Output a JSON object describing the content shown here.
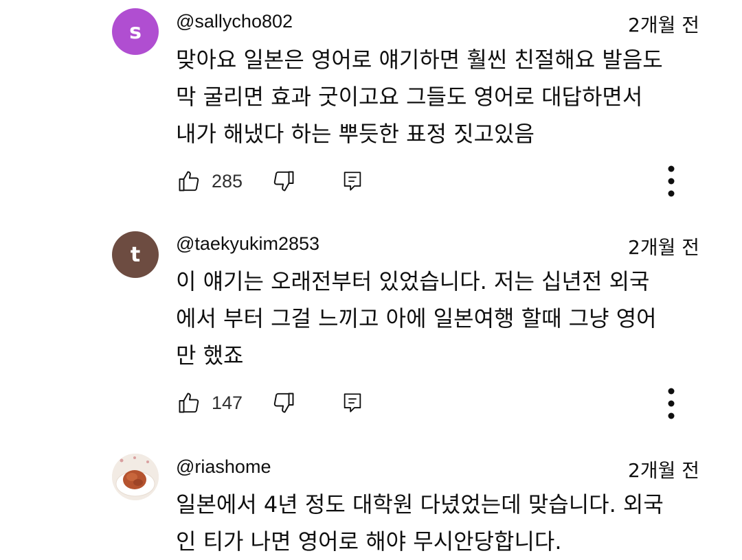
{
  "comments": [
    {
      "avatar_letter": "s",
      "avatar_color": "#b04ed1",
      "handle": "@sallycho802",
      "time": "2개월 전",
      "text": "맞아요 일본은 영어로 얘기하면 훨씬 친절해요 발음도\n막 굴리면 효과 굿이고요 그들도 영어로 대답하면서\n내가 해냈다 하는 뿌듯한 표정 짓고있음",
      "likes": "285"
    },
    {
      "avatar_letter": "t",
      "avatar_color": "#6d4c41",
      "handle": "@taekyukim2853",
      "time": "2개월 전",
      "text": "이 얘기는 오래전부터 있었습니다. 저는 십년전 외국\n에서 부터 그걸 느끼고  아에 일본여행 할때 그냥 영어\n만 했죠",
      "likes": "147"
    },
    {
      "avatar_letter": "",
      "avatar_color": "#f3ece6",
      "handle": "@riashome",
      "time": "2개월 전",
      "text": "일본에서 4년 정도 대학원 다녔었는데 맞습니다. 외국\n인 티가 나면 영어로 해야 무시안당합니다."
    }
  ],
  "icons": {
    "like": "thumbs-up-icon",
    "dislike": "thumbs-down-icon",
    "reply": "reply-comment-icon",
    "more": "more-vertical-icon"
  }
}
